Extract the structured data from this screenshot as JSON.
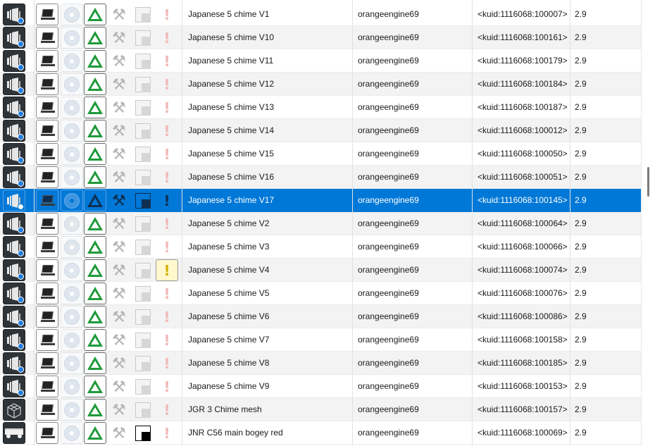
{
  "colors": {
    "selection": "#0078d7",
    "status_ok": "#1e9a3a",
    "warning": "#d4b100",
    "error_faded": "#f2b9b9",
    "local_badge": "#1e7de0"
  },
  "rows": [
    {
      "name": "Japanese 5 chime V1",
      "author": "orangeengine69",
      "kuid": "<kuid:1116068:100007>",
      "build": "2.9",
      "icon": "speaker-icon",
      "warning": false,
      "active_square": false,
      "selected": false
    },
    {
      "name": "Japanese 5 chime V10",
      "author": "orangeengine69",
      "kuid": "<kuid:1116068:100161>",
      "build": "2.9",
      "icon": "speaker-icon",
      "warning": false,
      "active_square": false,
      "selected": false
    },
    {
      "name": "Japanese 5 chime V11",
      "author": "orangeengine69",
      "kuid": "<kuid:1116068:100179>",
      "build": "2.9",
      "icon": "speaker-icon",
      "warning": false,
      "active_square": false,
      "selected": false
    },
    {
      "name": "Japanese 5 chime V12",
      "author": "orangeengine69",
      "kuid": "<kuid:1116068:100184>",
      "build": "2.9",
      "icon": "speaker-icon",
      "warning": false,
      "active_square": false,
      "selected": false
    },
    {
      "name": "Japanese 5 chime V13",
      "author": "orangeengine69",
      "kuid": "<kuid:1116068:100187>",
      "build": "2.9",
      "icon": "speaker-icon",
      "warning": false,
      "active_square": false,
      "selected": false
    },
    {
      "name": "Japanese 5 chime V14",
      "author": "orangeengine69",
      "kuid": "<kuid:1116068:100012>",
      "build": "2.9",
      "icon": "speaker-icon",
      "warning": false,
      "active_square": false,
      "selected": false
    },
    {
      "name": "Japanese 5 chime V15",
      "author": "orangeengine69",
      "kuid": "<kuid:1116068:100050>",
      "build": "2.9",
      "icon": "speaker-icon",
      "warning": false,
      "active_square": false,
      "selected": false
    },
    {
      "name": "Japanese 5 chime V16",
      "author": "orangeengine69",
      "kuid": "<kuid:1116068:100051>",
      "build": "2.9",
      "icon": "speaker-icon",
      "warning": false,
      "active_square": false,
      "selected": false
    },
    {
      "name": "Japanese 5 chime V17",
      "author": "orangeengine69",
      "kuid": "<kuid:1116068:100145>",
      "build": "2.9",
      "icon": "speaker-icon",
      "warning": false,
      "active_square": false,
      "selected": true
    },
    {
      "name": "Japanese 5 chime V2",
      "author": "orangeengine69",
      "kuid": "<kuid:1116068:100064>",
      "build": "2.9",
      "icon": "speaker-icon",
      "warning": false,
      "active_square": false,
      "selected": false
    },
    {
      "name": "Japanese 5 chime V3",
      "author": "orangeengine69",
      "kuid": "<kuid:1116068:100066>",
      "build": "2.9",
      "icon": "speaker-icon",
      "warning": false,
      "active_square": false,
      "selected": false
    },
    {
      "name": "Japanese 5 chime V4",
      "author": "orangeengine69",
      "kuid": "<kuid:1116068:100074>",
      "build": "2.9",
      "icon": "speaker-icon",
      "warning": true,
      "active_square": false,
      "selected": false
    },
    {
      "name": "Japanese 5 chime V5",
      "author": "orangeengine69",
      "kuid": "<kuid:1116068:100076>",
      "build": "2.9",
      "icon": "speaker-icon",
      "warning": false,
      "active_square": false,
      "selected": false
    },
    {
      "name": "Japanese 5 chime V6",
      "author": "orangeengine69",
      "kuid": "<kuid:1116068:100086>",
      "build": "2.9",
      "icon": "speaker-icon",
      "warning": false,
      "active_square": false,
      "selected": false
    },
    {
      "name": "Japanese 5 chime V7",
      "author": "orangeengine69",
      "kuid": "<kuid:1116068:100158>",
      "build": "2.9",
      "icon": "speaker-icon",
      "warning": false,
      "active_square": false,
      "selected": false
    },
    {
      "name": "Japanese 5 chime V8",
      "author": "orangeengine69",
      "kuid": "<kuid:1116068:100185>",
      "build": "2.9",
      "icon": "speaker-icon",
      "warning": false,
      "active_square": false,
      "selected": false
    },
    {
      "name": "Japanese 5 chime V9",
      "author": "orangeengine69",
      "kuid": "<kuid:1116068:100153>",
      "build": "2.9",
      "icon": "speaker-icon",
      "warning": false,
      "active_square": false,
      "selected": false
    },
    {
      "name": "JGR 3 Chime mesh",
      "author": "orangeengine69",
      "kuid": "<kuid:1116068:100157>",
      "build": "2.9",
      "icon": "mesh-cube-icon",
      "warning": false,
      "active_square": false,
      "selected": false
    },
    {
      "name": "JNR C56 main bogey red",
      "author": "orangeengine69",
      "kuid": "<kuid:1116068:100069>",
      "build": "2.9",
      "icon": "bogey-icon",
      "warning": false,
      "active_square": true,
      "selected": false
    }
  ]
}
